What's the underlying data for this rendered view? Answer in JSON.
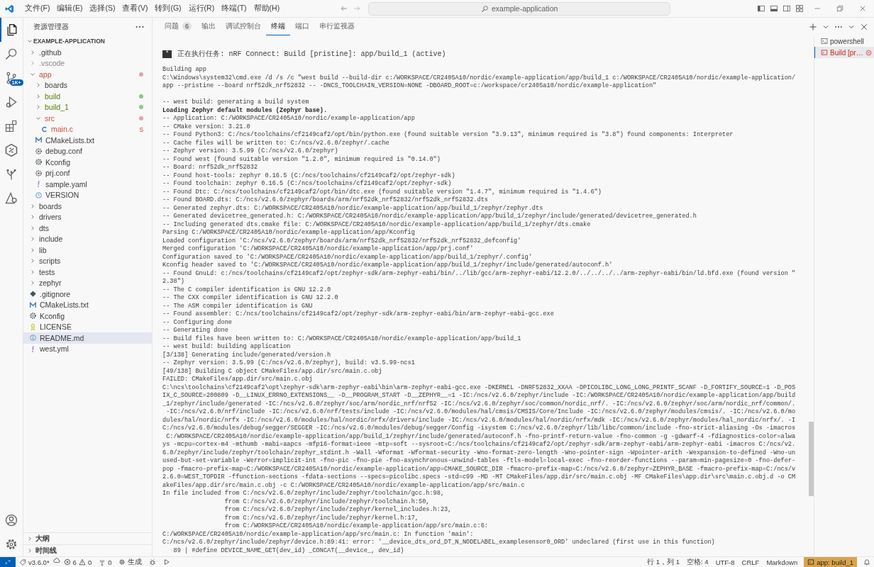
{
  "window": {
    "menu": [
      "文件(F)",
      "编辑(E)",
      "选择(S)",
      "查看(V)",
      "转到(G)",
      "运行(R)",
      "终端(T)",
      "帮助(H)"
    ],
    "search": {
      "text": "example-application"
    }
  },
  "activity_bar": {
    "items": [
      {
        "kind": "explorer",
        "selected": true
      },
      {
        "kind": "search",
        "selected": false
      },
      {
        "kind": "source-control",
        "selected": false,
        "badge": "1K+"
      },
      {
        "kind": "run-debug",
        "selected": false
      },
      {
        "kind": "extensions",
        "selected": false
      },
      {
        "kind": "nrf",
        "selected": false
      },
      {
        "kind": "tree",
        "selected": false
      },
      {
        "kind": "triangle",
        "selected": false
      }
    ],
    "bottom": [
      {
        "kind": "account"
      },
      {
        "kind": "settings"
      }
    ]
  },
  "sidebar": {
    "title": "资源管理器",
    "root": {
      "label": "EXAMPLE-APPLICATION",
      "expanded": true
    },
    "tree": [
      {
        "name": ".github",
        "kind": "folder",
        "expanded": false,
        "selected": false,
        "dot": false,
        "ignored": false,
        "error": false
      },
      {
        "name": ".vscode",
        "kind": "folder",
        "expanded": false,
        "selected": false,
        "dot": false,
        "ignored": true,
        "error": false
      },
      {
        "name": "app",
        "kind": "folder",
        "expanded": true,
        "selected": false,
        "dot": true,
        "color": "#e5a3a3",
        "ignored": false,
        "error": true,
        "children": [
          {
            "name": "boards",
            "kind": "folder",
            "expanded": false,
            "selected": false,
            "dot": false,
            "ignored": false,
            "error": false
          },
          {
            "name": "build",
            "kind": "folder",
            "expanded": false,
            "selected": false,
            "dot": true,
            "color": "#8ec78a",
            "ignored": false,
            "error": false,
            "untracked": true
          },
          {
            "name": "build_1",
            "kind": "folder",
            "expanded": false,
            "selected": false,
            "dot": true,
            "color": "#8ec78a",
            "ignored": false,
            "error": false,
            "untracked": true
          },
          {
            "name": "src",
            "kind": "folder",
            "expanded": true,
            "selected": false,
            "dot": true,
            "color": "#e5a3a3",
            "ignored": false,
            "error": true,
            "children": [
              {
                "name": "main.c",
                "kind": "c",
                "selected": false,
                "dot": false,
                "ignored": false,
                "error": true,
                "badge": "5"
              }
            ]
          },
          {
            "name": "CMakeLists.txt",
            "kind": "cmake",
            "selected": false,
            "dot": false,
            "ignored": false,
            "error": false
          },
          {
            "name": "debug.conf",
            "kind": "gear",
            "selected": false,
            "dot": false,
            "ignored": false,
            "error": false
          },
          {
            "name": "Kconfig",
            "kind": "kconfig",
            "selected": false,
            "dot": false,
            "ignored": false,
            "error": false
          },
          {
            "name": "prj.conf",
            "kind": "gear",
            "selected": false,
            "dot": false,
            "ignored": false,
            "error": false
          },
          {
            "name": "sample.yaml",
            "kind": "yaml",
            "selected": false,
            "dot": false,
            "ignored": false,
            "error": false
          },
          {
            "name": "VERSION",
            "kind": "version",
            "selected": false,
            "dot": false,
            "ignored": false,
            "error": false
          }
        ]
      },
      {
        "name": "boards",
        "kind": "folder",
        "expanded": false,
        "selected": false,
        "dot": false,
        "ignored": false,
        "error": false
      },
      {
        "name": "drivers",
        "kind": "folder",
        "expanded": false,
        "selected": false,
        "dot": false,
        "ignored": false,
        "error": false
      },
      {
        "name": "dts",
        "kind": "folder",
        "expanded": false,
        "selected": false,
        "dot": false,
        "ignored": false,
        "error": false
      },
      {
        "name": "include",
        "kind": "folder",
        "expanded": false,
        "selected": false,
        "dot": false,
        "ignored": false,
        "error": false
      },
      {
        "name": "lib",
        "kind": "folder",
        "expanded": false,
        "selected": false,
        "dot": false,
        "ignored": false,
        "error": false
      },
      {
        "name": "scripts",
        "kind": "folder",
        "expanded": false,
        "selected": false,
        "dot": false,
        "ignored": false,
        "error": false
      },
      {
        "name": "tests",
        "kind": "folder",
        "expanded": false,
        "selected": false,
        "dot": false,
        "ignored": false,
        "error": false
      },
      {
        "name": "zephyr",
        "kind": "folder",
        "expanded": false,
        "selected": false,
        "dot": false,
        "ignored": false,
        "error": false
      },
      {
        "name": ".gitignore",
        "kind": "gitignore",
        "selected": false,
        "dot": false,
        "ignored": false,
        "error": false
      },
      {
        "name": "CMakeLists.txt",
        "kind": "cmake",
        "selected": false,
        "dot": false,
        "ignored": false,
        "error": false
      },
      {
        "name": "Kconfig",
        "kind": "kconfig",
        "selected": false,
        "dot": false,
        "ignored": false,
        "error": false
      },
      {
        "name": "LICENSE",
        "kind": "license",
        "selected": false,
        "dot": false,
        "ignored": false,
        "error": false
      },
      {
        "name": "README.md",
        "kind": "readme",
        "selected": true,
        "dot": false,
        "ignored": false,
        "error": false
      },
      {
        "name": "west.yml",
        "kind": "yaml",
        "selected": false,
        "dot": false,
        "ignored": false,
        "error": false
      }
    ],
    "sections": [
      {
        "label": "大纲",
        "expanded": false
      },
      {
        "label": "时间线",
        "expanded": false
      }
    ]
  },
  "panel": {
    "tabs": [
      {
        "label": "问题",
        "badge": "6",
        "selected": false
      },
      {
        "label": "输出",
        "selected": false
      },
      {
        "label": "调试控制台",
        "selected": false
      },
      {
        "label": "终端",
        "selected": true
      },
      {
        "label": "端口",
        "selected": false
      },
      {
        "label": "串行监视器",
        "selected": false
      }
    ],
    "terminal": {
      "task_line": {
        "badge": "*",
        "text": "正在执行任务: nRF Connect: Build [pristine]: app/build_1 (active)"
      },
      "blocks": [
        [
          {
            "text": "Building app",
            "bold": false
          },
          {
            "text": "C:\\Windows\\system32\\cmd.exe /d /s /c \"west build --build-dir c:/WORKSPACE/CR2405A10/nordic/example-application/app/build_1 c:/WORKSPACE/CR2405A10/nordic/example-application/",
            "bold": false
          },
          {
            "text": "app --pristine --board nrf52dk_nrf52832 -- -DNCS_TOOLCHAIN_VERSION=NONE -DBOARD_ROOT=c:/workspace/cr2405a10/nordic/example-application\"",
            "bold": false
          }
        ],
        [
          {
            "text": "-- west build: generating a build system",
            "bold": false
          },
          {
            "text": "Loading Zephyr default modules (Zephyr base).",
            "bold": true
          },
          {
            "text": "-- Application: C:/WORKSPACE/CR2405A10/nordic/example-application/app",
            "bold": false
          },
          {
            "text": "-- CMake version: 3.21.0",
            "bold": false
          },
          {
            "text": "-- Found Python3: C:/ncs/toolchains/cf2149caf2/opt/bin/python.exe (found suitable version \"3.9.13\", minimum required is \"3.8\") found components: Interpreter",
            "bold": false
          },
          {
            "text": "-- Cache files will be written to: C:/ncs/v2.6.0/zephyr/.cache",
            "bold": false
          },
          {
            "text": "-- Zephyr version: 3.5.99 (C:/ncs/v2.6.0/zephyr)",
            "bold": false
          },
          {
            "text": "-- Found west (found suitable version \"1.2.0\", minimum required is \"0.14.0\")",
            "bold": false
          },
          {
            "text": "-- Board: nrf52dk_nrf52832",
            "bold": false
          },
          {
            "text": "-- Found host-tools: zephyr 0.16.5 (C:/ncs/toolchains/cf2149caf2/opt/zephyr-sdk)",
            "bold": false
          },
          {
            "text": "-- Found toolchain: zephyr 0.16.5 (C:/ncs/toolchains/cf2149caf2/opt/zephyr-sdk)",
            "bold": false
          },
          {
            "text": "-- Found Dtc: C:/ncs/toolchains/cf2149caf2/opt/bin/dtc.exe (found suitable version \"1.4.7\", minimum required is \"1.4.6\")",
            "bold": false
          },
          {
            "text": "-- Found BOARD.dts: C:/ncs/v2.6.0/zephyr/boards/arm/nrf52dk_nrf52832/nrf52dk_nrf52832.dts",
            "bold": false
          },
          {
            "text": "-- Generated zephyr.dts: C:/WORKSPACE/CR2405A10/nordic/example-application/app/build_1/zephyr/zephyr.dts",
            "bold": false
          },
          {
            "text": "-- Generated devicetree_generated.h: C:/WORKSPACE/CR2405A10/nordic/example-application/app/build_1/zephyr/include/generated/devicetree_generated.h",
            "bold": false
          },
          {
            "text": "-- Including generated dts.cmake file: C:/WORKSPACE/CR2405A10/nordic/example-application/app/build_1/zephyr/dts.cmake",
            "bold": false
          },
          {
            "text": "Parsing C:/WORKSPACE/CR2405A10/nordic/example-application/app/Kconfig",
            "bold": false
          },
          {
            "text": "Loaded configuration 'C:/ncs/v2.6.0/zephyr/boards/arm/nrf52dk_nrf52832/nrf52dk_nrf52832_defconfig'",
            "bold": false
          },
          {
            "text": "Merged configuration 'C:/WORKSPACE/CR2405A10/nordic/example-application/app/prj.conf'",
            "bold": false
          },
          {
            "text": "Configuration saved to 'C:/WORKSPACE/CR2405A10/nordic/example-application/app/build_1/zephyr/.config'",
            "bold": false
          },
          {
            "text": "Kconfig header saved to 'C:/WORKSPACE/CR2405A10/nordic/example-application/app/build_1/zephyr/include/generated/autoconf.h'",
            "bold": false
          },
          {
            "text": "-- Found GnuLd: c:/ncs/toolchains/cf2149caf2/opt/zephyr-sdk/arm-zephyr-eabi/bin/../lib/gcc/arm-zephyr-eabi/12.2.0/../../../../arm-zephyr-eabi/bin/ld.bfd.exe (found version \"",
            "bold": false
          },
          {
            "text": "2.38\")",
            "bold": false
          },
          {
            "text": "-- The C compiler identification is GNU 12.2.0",
            "bold": false
          },
          {
            "text": "-- The CXX compiler identification is GNU 12.2.0",
            "bold": false
          },
          {
            "text": "-- The ASM compiler identification is GNU",
            "bold": false
          },
          {
            "text": "-- Found assembler: C:/ncs/toolchains/cf2149caf2/opt/zephyr-sdk/arm-zephyr-eabi/bin/arm-zephyr-eabi-gcc.exe",
            "bold": false
          },
          {
            "text": "-- Configuring done",
            "bold": false
          },
          {
            "text": "-- Generating done",
            "bold": false
          },
          {
            "text": "-- Build files have been written to: C:/WORKSPACE/CR2405A10/nordic/example-application/app/build_1",
            "bold": false
          },
          {
            "text": "-- west build: building application",
            "bold": false
          },
          {
            "text": "[3/138] Generating include/generated/version.h",
            "bold": false
          },
          {
            "text": "-- Zephyr version: 3.5.99 (C:/ncs/v2.6.0/zephyr), build: v3.5.99-ncs1",
            "bold": false
          },
          {
            "text": "[49/138] Building C object CMakeFiles/app.dir/src/main.c.obj",
            "bold": false
          },
          {
            "text": "FAILED: CMakeFiles/app.dir/src/main.c.obj",
            "bold": false
          },
          {
            "text": "C:\\ncs\\toolchains\\cf2149caf2\\opt\\zephyr-sdk\\arm-zephyr-eabi\\bin\\arm-zephyr-eabi-gcc.exe -DKERNEL -DNRF52832_XXAA -DPICOLIBC_LONG_LONG_PRINTF_SCANF -D_FORTIFY_SOURCE=1 -D_POS",
            "bold": false
          },
          {
            "text": "IX_C_SOURCE=200809 -D__LINUX_ERRNO_EXTENSIONS__ -D__PROGRAM_START -D__ZEPHYR__=1 -IC:/ncs/v2.6.0/zephyr/include -IC:/WORKSPACE/CR2405A10/nordic/example-application/app/build",
            "bold": false
          },
          {
            "text": "_1/zephyr/include/generated -IC:/ncs/v2.6.0/zephyr/soc/arm/nordic_nrf/nrf52 -IC:/ncs/v2.6.0/zephyr/soc/common/nordic_nrf/. -IC:/ncs/v2.6.0/zephyr/soc/arm/nordic_nrf/common/.",
            "bold": false
          },
          {
            "text": " -IC:/ncs/v2.6.0/nrf/include -IC:/ncs/v2.6.0/nrf/tests/include -IC:/ncs/v2.6.0/modules/hal/cmsis/CMSIS/Core/Include -IC:/ncs/v2.6.0/zephyr/modules/cmsis/. -IC:/ncs/v2.6.0/mo",
            "bold": false
          },
          {
            "text": "dules/hal/nordic/nrfx -IC:/ncs/v2.6.0/modules/hal/nordic/nrfx/drivers/include -IC:/ncs/v2.6.0/modules/hal/nordic/nrfx/mdk -IC:/ncs/v2.6.0/zephyr/modules/hal_nordic/nrfx/. -I",
            "bold": false
          },
          {
            "text": "C:/ncs/v2.6.0/modules/debug/segger/SEGGER -IC:/ncs/v2.6.0/modules/debug/segger/Config -isystem C:/ncs/v2.6.0/zephyr/lib/libc/common/include -fno-strict-aliasing -Os -imacros",
            "bold": false
          },
          {
            "text": " C:/WORKSPACE/CR2405A10/nordic/example-application/app/build_1/zephyr/include/generated/autoconf.h -fno-printf-return-value -fno-common -g -gdwarf-4 -fdiagnostics-color=alwa",
            "bold": false
          },
          {
            "text": "ys -mcpu=cortex-m4 -mthumb -mabi=aapcs -mfp16-format=ieee -mtp=soft --sysroot=C:/ncs/toolchains/cf2149caf2/opt/zephyr-sdk/arm-zephyr-eabi/arm-zephyr-eabi -imacros C:/ncs/v2.",
            "bold": false
          },
          {
            "text": "6.0/zephyr/include/zephyr/toolchain/zephyr_stdint.h -Wall -Wformat -Wformat-security -Wno-format-zero-length -Wno-pointer-sign -Wpointer-arith -Wexpansion-to-defined -Wno-un",
            "bold": false
          },
          {
            "text": "used-but-set-variable -Werror=implicit-int -fno-pic -fno-pie -fno-asynchronous-unwind-tables -ftls-model=local-exec -fno-reorder-functions --param=min-pagesize=0 -fno-defer-",
            "bold": false
          },
          {
            "text": "pop -fmacro-prefix-map=C:/WORKSPACE/CR2405A10/nordic/example-application/app=CMAKE_SOURCE_DIR -fmacro-prefix-map=C:/ncs/v2.6.0/zephyr=ZEPHYR_BASE -fmacro-prefix-map=C:/ncs/v",
            "bold": false
          },
          {
            "text": "2.6.0=WEST_TOPDIR -ffunction-sections -fdata-sections --specs=picolibc.specs -std=c99 -MD -MT CMakeFiles/app.dir/src/main.c.obj -MF CMakeFiles\\app.dir\\src\\main.c.obj.d -o CM",
            "bold": false
          },
          {
            "text": "akeFiles/app.dir/src/main.c.obj -c C:/WORKSPACE/CR2405A10/nordic/example-application/app/src/main.c",
            "bold": false
          },
          {
            "text": "In file included from C:/ncs/v2.6.0/zephyr/include/zephyr/toolchain/gcc.h:98,",
            "bold": false
          },
          {
            "text": "                 from C:/ncs/v2.6.0/zephyr/include/zephyr/toolchain.h:50,",
            "bold": false
          },
          {
            "text": "                 from C:/ncs/v2.6.0/zephyr/include/zephyr/kernel_includes.h:23,",
            "bold": false
          },
          {
            "text": "                 from C:/ncs/v2.6.0/zephyr/include/zephyr/kernel.h:17,",
            "bold": false
          },
          {
            "text": "                 from C:/WORKSPACE/CR2405A10/nordic/example-application/app/src/main.c:6:",
            "bold": false
          },
          {
            "text": "C:/WORKSPACE/CR2405A10/nordic/example-application/app/src/main.c: In function 'main':",
            "bold": false
          },
          {
            "text": "C:/ncs/v2.6.0/zephyr/include/zephyr/device.h:89:41: error: '__device_dts_ord_DT_N_NODELABEL_examplesensor0_ORD' undeclared (first use in this function)",
            "bold": false
          },
          {
            "text": "   89 | #define DEVICE_NAME_GET(dev_id) _CONCAT(__device_, dev_id)",
            "bold": false
          }
        ]
      ]
    },
    "terminals": [
      {
        "label": "powershell",
        "kind": "shell",
        "selected": false,
        "error": false
      },
      {
        "label": "Build [pr…",
        "kind": "task",
        "selected": true,
        "error": true
      }
    ]
  },
  "status_bar": {
    "left": [
      {
        "kind": "remote"
      },
      {
        "kind": "version",
        "text": "v3.6.0*"
      },
      {
        "kind": "cloud"
      },
      {
        "kind": "problems",
        "errors": "6",
        "warnings": "0"
      },
      {
        "kind": "ports",
        "text": "0"
      },
      {
        "kind": "build",
        "text": "生成"
      },
      {
        "kind": "debug"
      },
      {
        "kind": "run"
      }
    ],
    "right": [
      {
        "kind": "text",
        "text": "行 1，列 1"
      },
      {
        "kind": "text",
        "text": "空格: 4"
      },
      {
        "kind": "text",
        "text": "UTF-8"
      },
      {
        "kind": "text",
        "text": "CRLF"
      },
      {
        "kind": "text",
        "text": "Markdown"
      },
      {
        "kind": "task",
        "text": "app: build_1"
      },
      {
        "kind": "bell"
      }
    ]
  }
}
